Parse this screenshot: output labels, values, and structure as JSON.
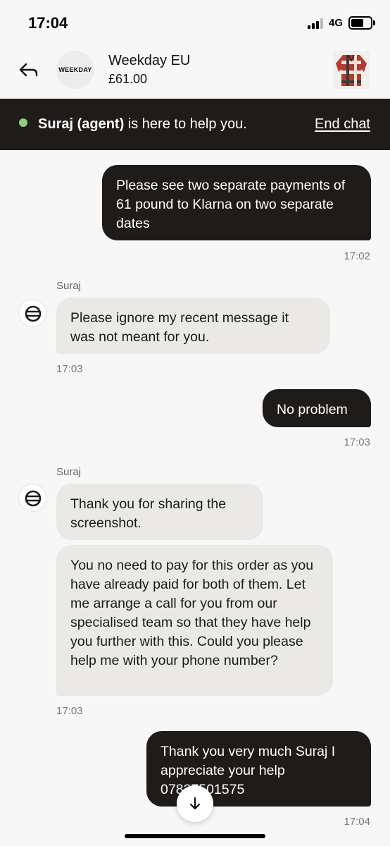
{
  "status_bar": {
    "time": "17:04",
    "network": "4G"
  },
  "header": {
    "brand_logo_text": "WEEKDAY",
    "shop_name": "Weekday EU",
    "price": "£61.00",
    "back_icon": "reply-arrow-icon",
    "product_image": "plaid-jacket-thumbnail"
  },
  "banner": {
    "agent_name": "Suraj (agent)",
    "agent_suffix": " is here to help you.",
    "end_chat_label": "End chat",
    "status_color": "#8fce7d"
  },
  "messages": [
    {
      "direction": "outgoing",
      "text": "Please see two separate payments of 61 pound to Klarna on two separate dates",
      "time": "17:02"
    },
    {
      "direction": "incoming",
      "sender": "Suraj",
      "text": "Please ignore my recent message it was not meant for you.",
      "time": "17:03"
    },
    {
      "direction": "outgoing",
      "text": "No problem",
      "time": "17:03"
    },
    {
      "direction": "incoming",
      "sender": "Suraj",
      "text": "Thank you for sharing the screenshot."
    },
    {
      "direction": "incoming",
      "text": "You no need to pay for this order as you have already paid for both of them. Let me arrange a call for you from our specialised team so that they have help you further with this. Could you please help me with your phone number?",
      "time": "17:03"
    },
    {
      "direction": "outgoing",
      "text": "Thank you very much Suraj I appreciate your help 07827501575",
      "time": "17:04"
    }
  ],
  "scroll_button_icon": "arrow-down-icon",
  "colors": {
    "outgoing_bubble": "#1f1b19",
    "incoming_bubble": "#ebe9e6",
    "background": "#f7f7f7"
  }
}
